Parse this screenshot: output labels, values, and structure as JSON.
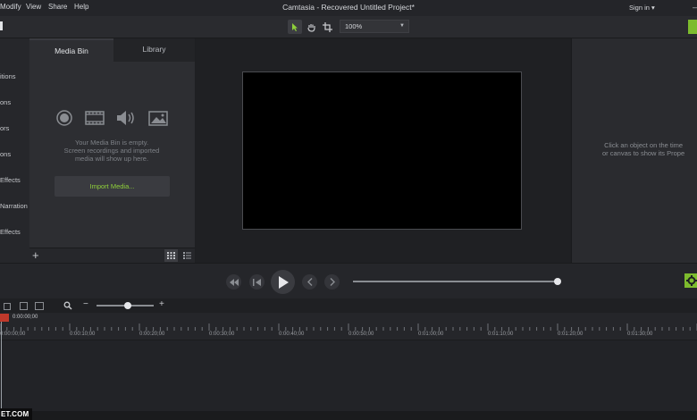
{
  "menu": {
    "items": [
      "Modify",
      "View",
      "Share",
      "Help"
    ]
  },
  "window": {
    "title": "Camtasia - Recovered  Untitled Project*"
  },
  "account": {
    "signin": "Sign in ▾"
  },
  "toolbar": {
    "zoom": "100%",
    "tools": [
      "select-icon",
      "pan-icon",
      "crop-icon"
    ]
  },
  "tools_panel": {
    "items": [
      "itions",
      "ons",
      "ors",
      "ons",
      "Effects",
      "Narration",
      "Effects"
    ]
  },
  "media_bin": {
    "tabs": [
      "Media Bin",
      "Library"
    ],
    "empty_line1": "Your Media Bin is empty.",
    "empty_line2": "Screen recordings and imported",
    "empty_line3": "media will show up here.",
    "import_button": "Import Media..."
  },
  "properties": {
    "line1": "Click an object on the time",
    "line2": "or canvas to show its Prope"
  },
  "timeline": {
    "playhead_time": "0:00:00;00",
    "ticks": [
      "0:00:00;00",
      "0:00:10;00",
      "0:00:20;00",
      "0:00:30;00",
      "0:00:40;00",
      "0:00:50;00",
      "0:01:00;00",
      "0:01:10;00",
      "0:01:20;00",
      "0:01:30;00"
    ],
    "zoom_level": 0.55
  },
  "watermark": {
    "text": "ET.COM"
  },
  "colors": {
    "accent": "#7dbb2d",
    "playhead": "#c0392b"
  }
}
